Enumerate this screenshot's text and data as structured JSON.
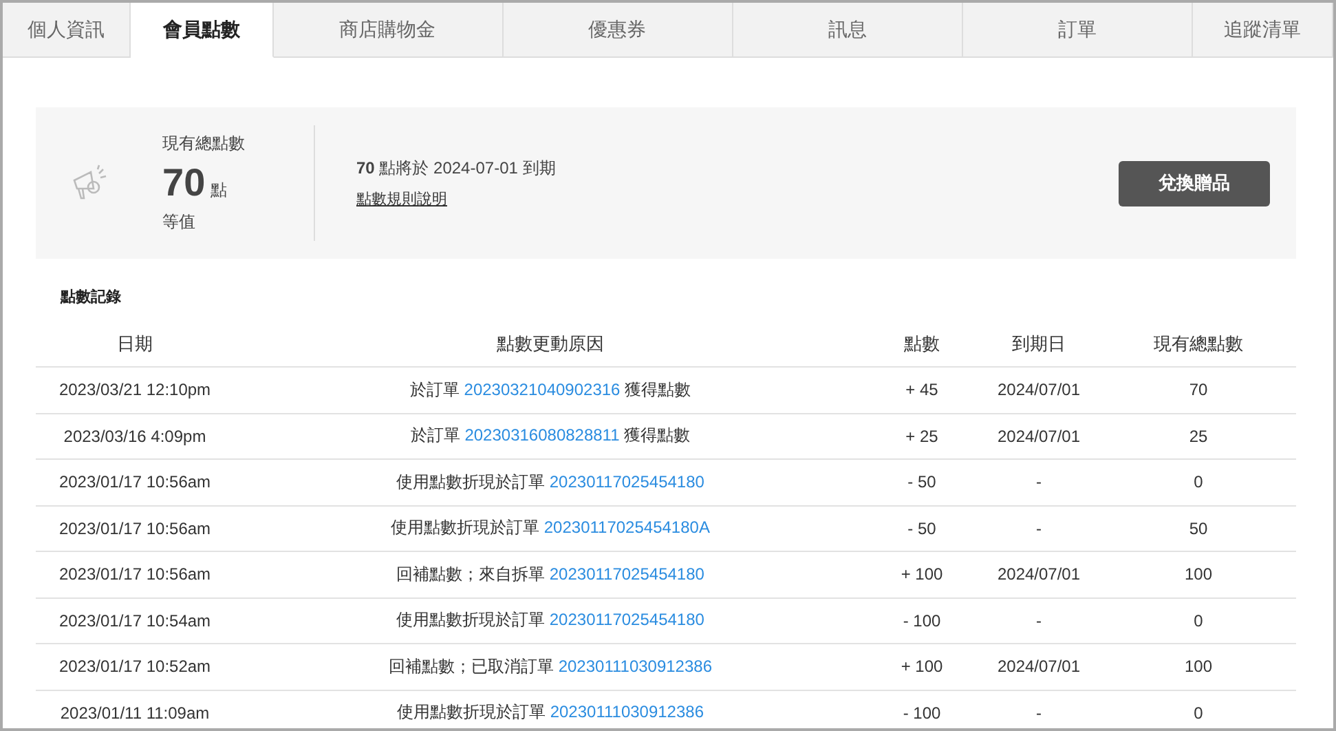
{
  "tabs": [
    {
      "label": "個人資訊",
      "selected": false
    },
    {
      "label": "會員點數",
      "selected": true
    },
    {
      "label": "商店購物金",
      "selected": false
    },
    {
      "label": "優惠券",
      "selected": false
    },
    {
      "label": "訊息",
      "selected": false
    },
    {
      "label": "訂單",
      "selected": false
    },
    {
      "label": "追蹤清單",
      "selected": false
    }
  ],
  "summary": {
    "label": "現有總點數",
    "points": "70",
    "unit": "點",
    "equivalent": "等值",
    "expiry_points": "70",
    "expiry_text": "點將於 2024-07-01 到期",
    "rules_link": "點數規則說明",
    "redeem_button": "兌換贈品"
  },
  "history": {
    "title": "點數記錄",
    "columns": [
      "日期",
      "點數更動原因",
      "點數",
      "到期日",
      "現有總點數"
    ],
    "rows": [
      {
        "date": "2023/03/21 12:10pm",
        "reason_before": "於訂單",
        "order": "20230321040902316",
        "reason_after": "獲得點數",
        "points": "+ 45",
        "expiry": "2024/07/01",
        "total": "70"
      },
      {
        "date": "2023/03/16 4:09pm",
        "reason_before": "於訂單",
        "order": "20230316080828811",
        "reason_after": "獲得點數",
        "points": "+ 25",
        "expiry": "2024/07/01",
        "total": "25"
      },
      {
        "date": "2023/01/17 10:56am",
        "reason_before": "使用點數折現於訂單",
        "order": "20230117025454180",
        "points": "- 50",
        "expiry": "-",
        "total": "0"
      },
      {
        "date": "2023/01/17 10:56am",
        "reason_before": "使用點數折現於訂單",
        "order": "20230117025454180A",
        "points": "- 50",
        "expiry": "-",
        "total": "50"
      },
      {
        "date": "2023/01/17 10:56am",
        "reason_before": "回補點數；來自拆單",
        "order": "20230117025454180",
        "points": "+ 100",
        "expiry": "2024/07/01",
        "total": "100"
      },
      {
        "date": "2023/01/17 10:54am",
        "reason_before": "使用點數折現於訂單",
        "order": "20230117025454180",
        "points": "- 100",
        "expiry": "-",
        "total": "0"
      },
      {
        "date": "2023/01/17 10:52am",
        "reason_before": "回補點數；已取消訂單",
        "order": "20230111030912386",
        "points": "+ 100",
        "expiry": "2024/07/01",
        "total": "100"
      },
      {
        "date": "2023/01/11 11:09am",
        "reason_before": "使用點數折現於訂單",
        "order": "20230111030912386",
        "points": "- 100",
        "expiry": "-",
        "total": "0"
      }
    ]
  }
}
